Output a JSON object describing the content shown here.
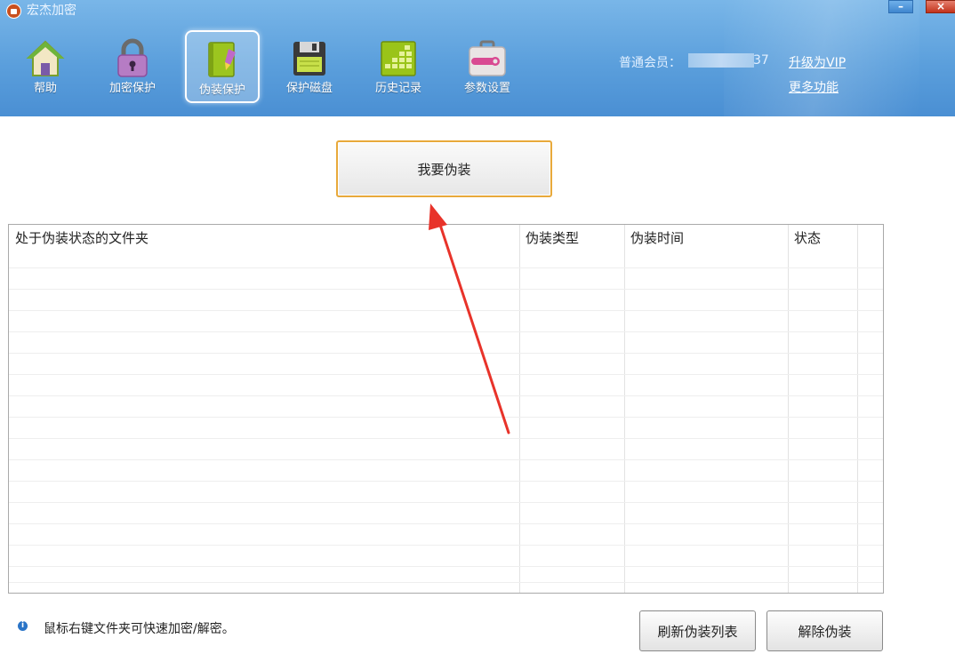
{
  "window": {
    "title": "宏杰加密",
    "minimize": "–",
    "close": "×"
  },
  "toolbar": {
    "items": [
      {
        "label": "帮助",
        "icon": "house-icon"
      },
      {
        "label": "加密保护",
        "icon": "padlock-icon"
      },
      {
        "label": "伪装保护",
        "icon": "disguise-book-icon",
        "active": true
      },
      {
        "label": "保护磁盘",
        "icon": "floppy-disk-icon"
      },
      {
        "label": "历史记录",
        "icon": "history-grid-icon"
      },
      {
        "label": "参数设置",
        "icon": "wrench-toolbox-icon"
      }
    ]
  },
  "account": {
    "member_label": "普通会员：",
    "member_suffix": "37",
    "upgrade_link": "升级为VIP",
    "more_link": "更多功能"
  },
  "main": {
    "disguise_button": "我要伪装",
    "table": {
      "columns": [
        "处于伪装状态的文件夹",
        "伪装类型",
        "伪装时间",
        "状态"
      ],
      "rows": []
    },
    "tip": "鼠标右键文件夹可快速加密/解密。",
    "refresh_button": "刷新伪装列表",
    "remove_button": "解除伪装"
  },
  "colors": {
    "header": "#5b9fdc",
    "active_border": "#ffffff",
    "button_highlight": "#e8a93b",
    "arrow": "#e8332a"
  }
}
